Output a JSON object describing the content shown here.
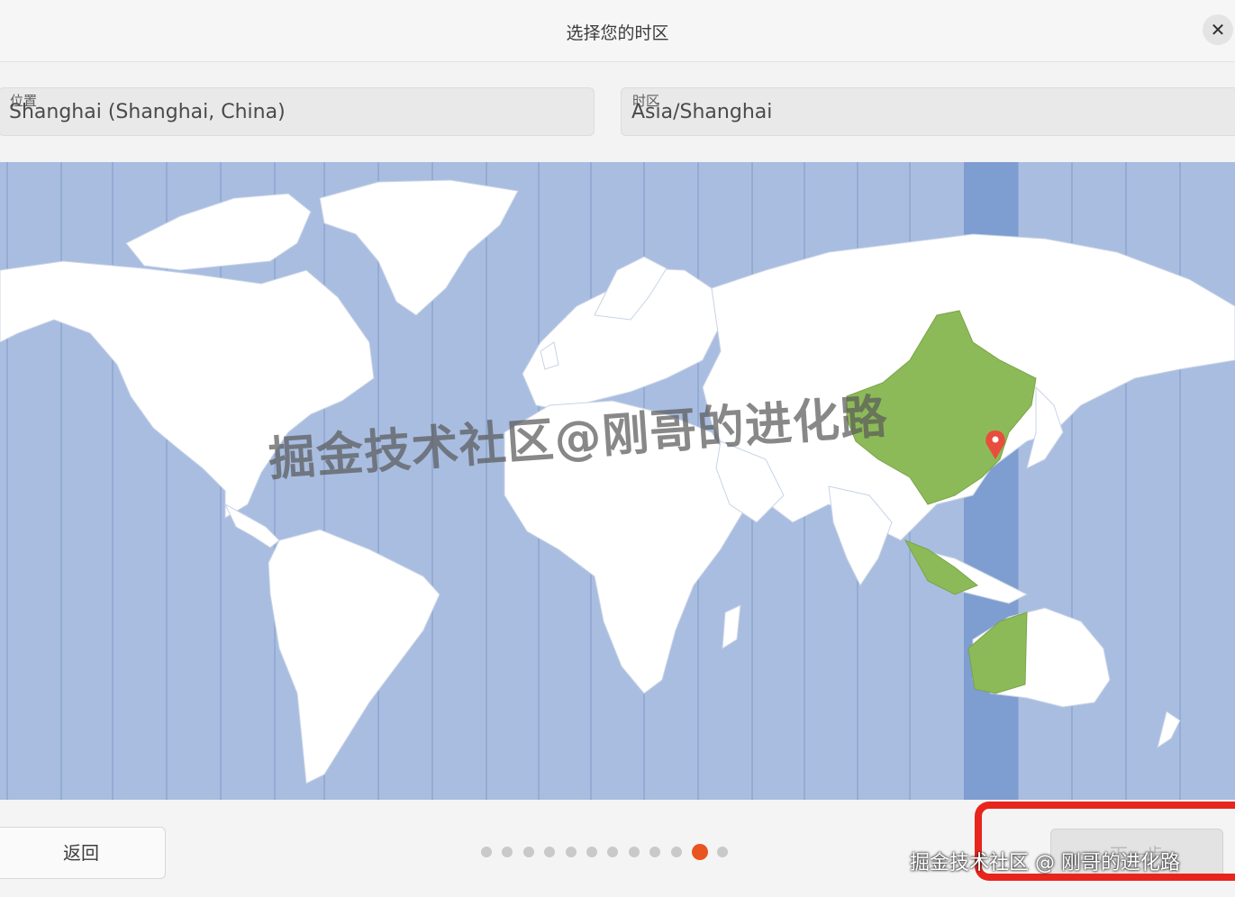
{
  "window": {
    "title": "选择您的时区",
    "close_label": "✕"
  },
  "location": {
    "label": "位置",
    "value": "Shanghai (Shanghai, China)"
  },
  "timezone": {
    "label": "时区",
    "value": "Asia/Shanghai"
  },
  "map": {
    "selected_city": "Shanghai",
    "ocean_color": "#a9bde0",
    "band_color": "#7e9dd1",
    "highlight_region_color": "#8dba58",
    "pin_color": "#e84d3d",
    "land_color": "#ffffff"
  },
  "watermark": {
    "text": "掘金技术社区@刚哥的进化路"
  },
  "footer": {
    "back_label": "返回",
    "next_label": "下一步",
    "steps_total": 12,
    "current_step": 11,
    "accent_color": "#e95420",
    "corner_watermark": "掘金技术社区 @ 刚哥的进化路"
  }
}
